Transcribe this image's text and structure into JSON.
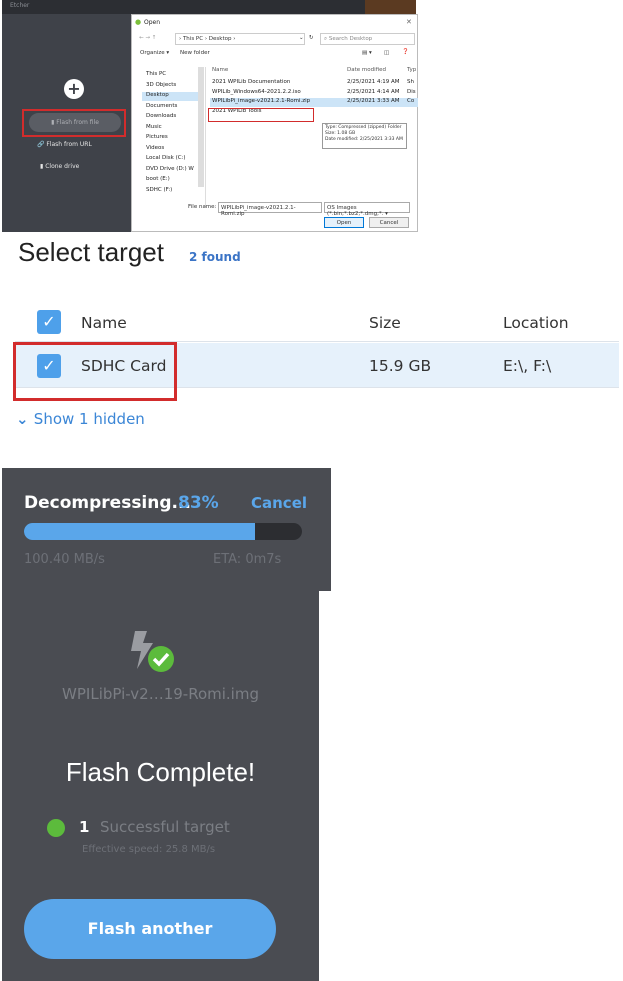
{
  "etcher": {
    "window_title": "Etcher",
    "flash_from_file": "Flash from file",
    "flash_from_url": "Flash from URL",
    "clone_drive": "Clone drive"
  },
  "open_dialog": {
    "title": "Open",
    "breadcrumb": "› This PC › Desktop ›",
    "search_placeholder": "Search Desktop",
    "organize": "Organize ▾",
    "new_folder": "New folder",
    "nav_items": [
      "This PC",
      "3D Objects",
      "Desktop",
      "Documents",
      "Downloads",
      "Music",
      "Pictures",
      "Videos",
      "Local Disk (C:)",
      "DVD Drive (D:) W",
      "boot (E:)",
      "SDHC (F:)"
    ],
    "nav_selected_index": 2,
    "columns": [
      "Name",
      "Date modified",
      "Typ"
    ],
    "files": [
      {
        "name": "2021 WPILib Documentation",
        "date": "2/25/2021 4:19 AM",
        "type": "Sh"
      },
      {
        "name": "WPILib_Windows64-2021.2.2.iso",
        "date": "2/25/2021 4:14 AM",
        "type": "Dis"
      },
      {
        "name": "WPILibPi_image-v2021.2.1-Romi.zip",
        "date": "2/25/2021 3:33 AM",
        "type": "Co"
      },
      {
        "name": "2021 WPILib Tools",
        "date": "",
        "type": ""
      }
    ],
    "selected_file_index": 2,
    "tooltip": [
      "Type: Compressed (zipped) Folder",
      "Size: 1.08 GB",
      "Date modified: 2/25/2021 3:33 AM"
    ],
    "file_name_label": "File name:",
    "file_name_value": "WPILibPi_image-v2021.2.1-Romi.zip",
    "file_type": "OS Images (*.bin;*.bz2;*.dmg;*. ▾",
    "open_label": "Open",
    "cancel_label": "Cancel"
  },
  "select_target": {
    "title": "Select target",
    "found": "2 found",
    "columns": {
      "name": "Name",
      "size": "Size",
      "location": "Location"
    },
    "row": {
      "name": "SDHC Card",
      "size": "15.9 GB",
      "location": "E:\\, F:\\"
    },
    "show_hidden": "Show 1 hidden"
  },
  "decompress": {
    "label": "Decompressing...",
    "percent_text": "83%",
    "percent": 83,
    "cancel": "Cancel",
    "speed": "100.40 MB/s",
    "eta": "ETA: 0m7s"
  },
  "complete": {
    "image_name": "WPILibPi-v2…19-Romi.img",
    "title": "Flash Complete!",
    "success_count": "1",
    "success_label": "Successful target",
    "effective_speed": "Effective speed: 25.8 MB/s",
    "button": "Flash another"
  },
  "colors": {
    "accent": "#5aa6ea",
    "success": "#5cbb3c",
    "highlight": "#d22c2c"
  }
}
